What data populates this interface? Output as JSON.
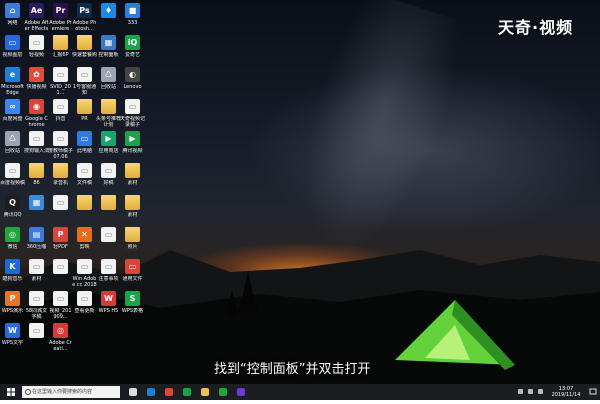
{
  "watermark": "天奇·视频",
  "subtitle": "找到“控制面板”并双击打开",
  "taskbar": {
    "search_placeholder": "在这里输入你要搜索的内容",
    "time": "13:07",
    "date": "2019/11/14"
  },
  "desktop_icons": [
    {
      "label": "网络",
      "color": "#3b7dd8",
      "glyph": "⌂"
    },
    {
      "label": "Adobe After Effects CC ...",
      "color": "#2a1a5e",
      "glyph": "Ae"
    },
    {
      "label": "Adobe Premiere P...",
      "color": "#2a0f4a",
      "glyph": "Pr"
    },
    {
      "label": "Adobe Photosh...",
      "color": "#0f2a4a",
      "glyph": "Ps"
    },
    {
      "label": "",
      "color": "#1e88e5",
      "glyph": "♦"
    },
    {
      "label": "333",
      "color": "#2a7de1",
      "glyph": "■"
    },
    {
      "label": "视频图层",
      "color": "#2a6ad8",
      "glyph": "▭"
    },
    {
      "label": "轻视频",
      "color": "#f2f2f2",
      "glyph": "▭"
    },
    {
      "label": "汇报6P",
      "color": "#e8c15a",
      "glyph": ""
    },
    {
      "label": "快速套餐购",
      "color": "#e8c15a",
      "glyph": ""
    },
    {
      "label": "控制面板",
      "color": "#3a78c8",
      "glyph": "▦"
    },
    {
      "label": "爱奇艺",
      "color": "#1aa34a",
      "glyph": "iQ"
    },
    {
      "label": "Microsoft Edge",
      "color": "#1e7fd6",
      "glyph": "e"
    },
    {
      "label": "快播视频",
      "color": "#e04b3a",
      "glyph": "✿"
    },
    {
      "label": "SVID_201...",
      "color": "#f2f2f2",
      "glyph": "▭"
    },
    {
      "label": "1号客服通知",
      "color": "#f2f2f2",
      "glyph": "▭"
    },
    {
      "label": "回收站",
      "color": "#9aa4b2",
      "glyph": "♺"
    },
    {
      "label": "Lenovo",
      "color": "#444",
      "glyph": "◐"
    },
    {
      "label": "百度网盘",
      "color": "#3b87f2",
      "glyph": "∞"
    },
    {
      "label": "Google Chrome",
      "color": "#db4437",
      "glyph": "◉"
    },
    {
      "label": "抖音",
      "color": "#f2f2f2",
      "glyph": "▭"
    },
    {
      "label": "PR",
      "color": "#e8c15a",
      "glyph": ""
    },
    {
      "label": "头条号推荐计划",
      "color": "#e8c15a",
      "glyph": ""
    },
    {
      "label": "天奇视频记录稿子",
      "color": "#f2f2f2",
      "glyph": "▭"
    },
    {
      "label": "回收站",
      "color": "#9aa4b2",
      "glyph": "♺"
    },
    {
      "label": "搜狗输入法",
      "color": "#f2f2f2",
      "glyph": "▭"
    },
    {
      "label": "度教师稿子07.06",
      "color": "#f2f2f2",
      "glyph": "▭"
    },
    {
      "label": "此电脑",
      "color": "#2d7be0",
      "glyph": "▭"
    },
    {
      "label": "应用商店",
      "color": "#1aa36a",
      "glyph": "▶"
    },
    {
      "label": "腾讯视频",
      "color": "#1aa34a",
      "glyph": "▶"
    },
    {
      "label": "百度视频稿",
      "color": "#f2f2f2",
      "glyph": "▭"
    },
    {
      "label": "86",
      "color": "#e8c15a",
      "glyph": ""
    },
    {
      "label": "录音机",
      "color": "#e8c15a",
      "glyph": ""
    },
    {
      "label": "文件稿",
      "color": "#f2f2f2",
      "glyph": "▭"
    },
    {
      "label": "好稿",
      "color": "#f2f2f2",
      "glyph": "▭"
    },
    {
      "label": "素材",
      "color": "#e8c15a",
      "glyph": ""
    },
    {
      "label": "腾讯QQ",
      "color": "#1e1e1e",
      "glyph": "Q"
    },
    {
      "label": "",
      "color": "#3a8cd8",
      "glyph": "▦"
    },
    {
      "label": "",
      "color": "#f2f2f2",
      "glyph": "▭"
    },
    {
      "label": "",
      "color": "#e8c15a",
      "glyph": ""
    },
    {
      "label": "",
      "color": "#e8c15a",
      "glyph": ""
    },
    {
      "label": "素材",
      "color": "#e8c15a",
      "glyph": ""
    },
    {
      "label": "微信",
      "color": "#22a83a",
      "glyph": "◎"
    },
    {
      "label": "360压缩",
      "color": "#3a7cd8",
      "glyph": "▤"
    },
    {
      "label": "轻PDF",
      "color": "#d8453a",
      "glyph": "P"
    },
    {
      "label": "剪映",
      "color": "#e86a1a",
      "glyph": "✕"
    },
    {
      "label": "",
      "color": "#f2f2f2",
      "glyph": "▭"
    },
    {
      "label": "照片",
      "color": "#e8c15a",
      "glyph": ""
    },
    {
      "label": "酷狗音乐",
      "color": "#1a6ad8",
      "glyph": "K"
    },
    {
      "label": "素材",
      "color": "#f2f2f2",
      "glyph": "▭"
    },
    {
      "label": "",
      "color": "#f2f2f2",
      "glyph": "▭"
    },
    {
      "label": "Win Adobe cc 2018",
      "color": "#f2f2f2",
      "glyph": "▭"
    },
    {
      "label": "注意事项",
      "color": "#f2f2f2",
      "glyph": "▭"
    },
    {
      "label": "通用文件",
      "color": "#d8453a",
      "glyph": "▭"
    },
    {
      "label": "WPS演示",
      "color": "#e8742a",
      "glyph": "P"
    },
    {
      "label": "58同城文字稿",
      "color": "#f2f2f2",
      "glyph": "▭"
    },
    {
      "label": "视频_201909...",
      "color": "#f2f2f2",
      "glyph": "▭"
    },
    {
      "label": "查看更新",
      "color": "#f2f2f2",
      "glyph": "▭"
    },
    {
      "label": "WPS H5",
      "color": "#d83a3a",
      "glyph": "W"
    },
    {
      "label": "WPS表格",
      "color": "#1aa34a",
      "glyph": "S"
    },
    {
      "label": "WPS文字",
      "color": "#2a6ad8",
      "glyph": "W"
    },
    {
      "label": "",
      "color": "#f2f2f2",
      "glyph": "▭"
    },
    {
      "label": "Adobe Creati...",
      "color": "#d83a3a",
      "glyph": "◎"
    }
  ],
  "taskbar_apps": [
    {
      "name": "task-view",
      "color": "#ddd"
    },
    {
      "name": "edge",
      "color": "#1e7fd6"
    },
    {
      "name": "chrome",
      "color": "#db4437"
    },
    {
      "name": "iqiyi",
      "color": "#1aa34a"
    },
    {
      "name": "explorer",
      "color": "#e8c15a"
    },
    {
      "name": "wechat",
      "color": "#22a83a"
    },
    {
      "name": "premiere",
      "color": "#6a3ad8"
    }
  ]
}
